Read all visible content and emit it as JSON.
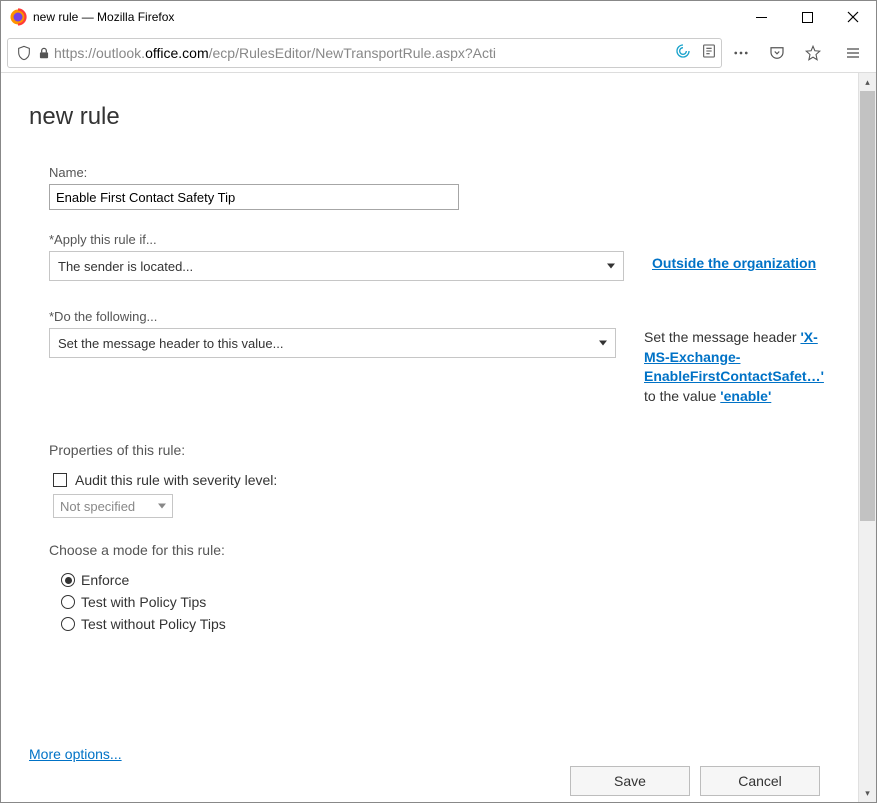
{
  "window": {
    "title": "new rule — Mozilla Firefox"
  },
  "addressbar": {
    "url_pre": "https://outlook.",
    "url_domain": "office.com",
    "url_path": "/ecp/RulesEditor/NewTransportRule.aspx?Acti"
  },
  "page": {
    "title": "new rule",
    "name_label": "Name:",
    "name_value": "Enable First Contact Safety Tip",
    "apply_label": "*Apply this rule if...",
    "apply_selected": "The sender is located...",
    "apply_side_link": "Outside the organization",
    "do_label": "*Do the following...",
    "do_selected": "Set the message header to this value...",
    "do_side_prefix": "Set the message header ",
    "do_side_header": "'X-MS-Exchange-EnableFirstContactSafet…'",
    "do_side_mid": " to the value ",
    "do_side_value": "'enable'",
    "properties_label": "Properties of this rule:",
    "audit_label": "Audit this rule with severity level:",
    "severity_value": "Not specified",
    "mode_label": "Choose a mode for this rule:",
    "mode_options": {
      "enforce": "Enforce",
      "test_tips": "Test with Policy Tips",
      "test_notips": "Test without Policy Tips"
    },
    "more_options": "More options...",
    "save_label": "Save",
    "cancel_label": "Cancel"
  }
}
